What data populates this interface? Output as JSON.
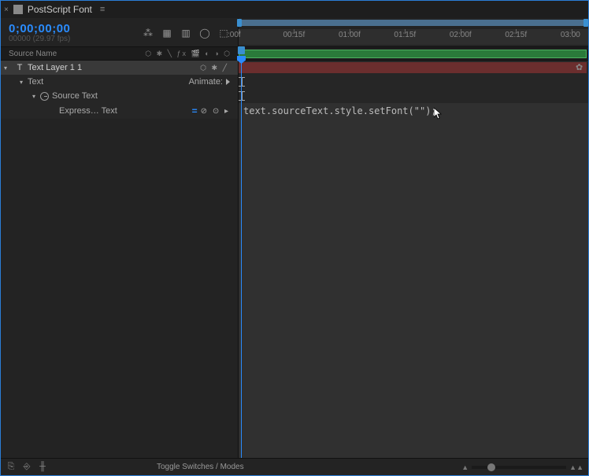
{
  "tab": {
    "title": "PostScript Font"
  },
  "timecode": {
    "value": "0;00;00;00",
    "fps": "00000 (29.97 fps)"
  },
  "columns": {
    "source_name": "Source Name",
    "switches": "⬡ ✱ ╲ ƒx 🎬 ◐ ◑ ⬡"
  },
  "layer": {
    "number": "1",
    "name": "Text Layer 1",
    "switches": "⬡ ✱ ╱",
    "text_group": "Text",
    "animate_label": "Animate:",
    "source_text": "Source Text",
    "expression_label": "Express… Text",
    "expression_icons": "⊘ ⊙ ▸"
  },
  "expression": {
    "code": "text.sourceText.style.setFont(\"\");"
  },
  "timeline": {
    "ticks": [
      ":00f",
      "00:15f",
      "01:00f",
      "01:15f",
      "02:00f",
      "02:15f",
      "03:00"
    ]
  },
  "footer": {
    "toggle_label": "Toggle Switches / Modes",
    "mountain_left": "▲",
    "mountain_right": "▲▲"
  }
}
